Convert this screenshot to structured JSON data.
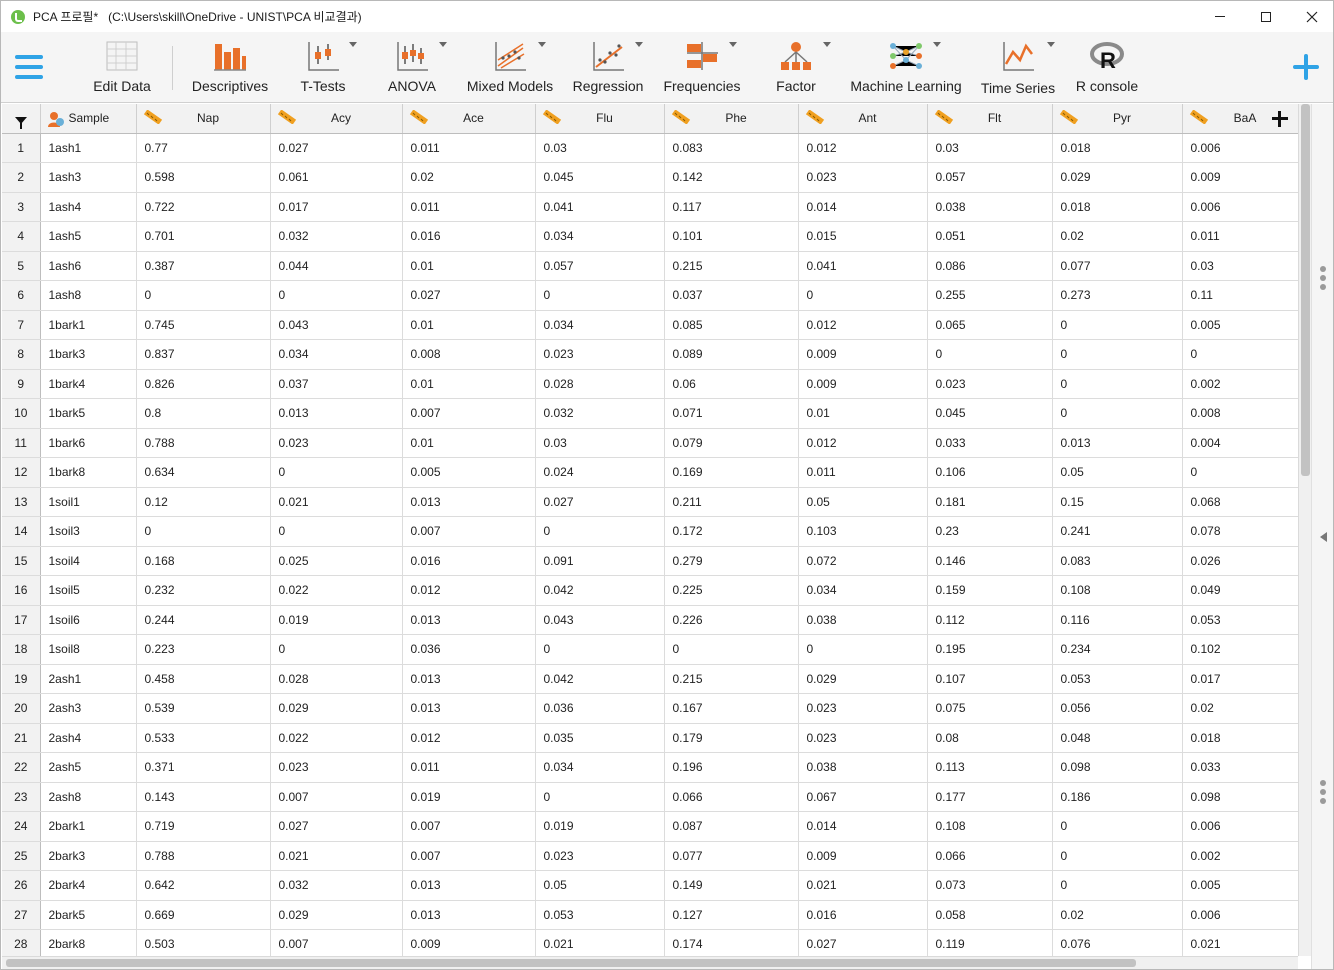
{
  "window": {
    "title": "PCA 프로필*",
    "path": "(C:\\Users\\skill\\OneDrive - UNIST\\PCA 비교결과)"
  },
  "ribbon": {
    "items": [
      {
        "label": "Edit Data",
        "icon": "spreadsheet-icon"
      },
      {
        "label": "Descriptives",
        "icon": "bar-chart-icon"
      },
      {
        "label": "T-Tests",
        "icon": "ttest-icon"
      },
      {
        "label": "ANOVA",
        "icon": "anova-icon"
      },
      {
        "label": "Mixed Models",
        "icon": "mixed-models-icon"
      },
      {
        "label": "Regression",
        "icon": "regression-icon"
      },
      {
        "label": "Frequencies",
        "icon": "frequencies-icon"
      },
      {
        "label": "Factor",
        "icon": "factor-icon"
      },
      {
        "label": "Machine Learning",
        "icon": "machine-learning-icon"
      },
      {
        "label": "Time Series",
        "icon": "time-series-icon"
      },
      {
        "label": "R console",
        "icon": "r-logo-icon"
      }
    ]
  },
  "grid": {
    "columns": [
      "Sample",
      "Nap",
      "Acy",
      "Ace",
      "Flu",
      "Phe",
      "Ant",
      "Flt",
      "Pyr",
      "BaA"
    ],
    "rows": [
      [
        "1",
        "1ash1",
        "0.77",
        "0.027",
        "0.011",
        "0.03",
        "0.083",
        "0.012",
        "0.03",
        "0.018",
        "0.006"
      ],
      [
        "2",
        "1ash3",
        "0.598",
        "0.061",
        "0.02",
        "0.045",
        "0.142",
        "0.023",
        "0.057",
        "0.029",
        "0.009"
      ],
      [
        "3",
        "1ash4",
        "0.722",
        "0.017",
        "0.011",
        "0.041",
        "0.117",
        "0.014",
        "0.038",
        "0.018",
        "0.006"
      ],
      [
        "4",
        "1ash5",
        "0.701",
        "0.032",
        "0.016",
        "0.034",
        "0.101",
        "0.015",
        "0.051",
        "0.02",
        "0.011"
      ],
      [
        "5",
        "1ash6",
        "0.387",
        "0.044",
        "0.01",
        "0.057",
        "0.215",
        "0.041",
        "0.086",
        "0.077",
        "0.03"
      ],
      [
        "6",
        "1ash8",
        "0",
        "0",
        "0.027",
        "0",
        "0.037",
        "0",
        "0.255",
        "0.273",
        "0.11"
      ],
      [
        "7",
        "1bark1",
        "0.745",
        "0.043",
        "0.01",
        "0.034",
        "0.085",
        "0.012",
        "0.065",
        "0",
        "0.005"
      ],
      [
        "8",
        "1bark3",
        "0.837",
        "0.034",
        "0.008",
        "0.023",
        "0.089",
        "0.009",
        "0",
        "0",
        "0"
      ],
      [
        "9",
        "1bark4",
        "0.826",
        "0.037",
        "0.01",
        "0.028",
        "0.06",
        "0.009",
        "0.023",
        "0",
        "0.002"
      ],
      [
        "10",
        "1bark5",
        "0.8",
        "0.013",
        "0.007",
        "0.032",
        "0.071",
        "0.01",
        "0.045",
        "0",
        "0.008"
      ],
      [
        "11",
        "1bark6",
        "0.788",
        "0.023",
        "0.01",
        "0.03",
        "0.079",
        "0.012",
        "0.033",
        "0.013",
        "0.004"
      ],
      [
        "12",
        "1bark8",
        "0.634",
        "0",
        "0.005",
        "0.024",
        "0.169",
        "0.011",
        "0.106",
        "0.05",
        "0"
      ],
      [
        "13",
        "1soil1",
        "0.12",
        "0.021",
        "0.013",
        "0.027",
        "0.211",
        "0.05",
        "0.181",
        "0.15",
        "0.068"
      ],
      [
        "14",
        "1soil3",
        "0",
        "0",
        "0.007",
        "0",
        "0.172",
        "0.103",
        "0.23",
        "0.241",
        "0.078"
      ],
      [
        "15",
        "1soil4",
        "0.168",
        "0.025",
        "0.016",
        "0.091",
        "0.279",
        "0.072",
        "0.146",
        "0.083",
        "0.026"
      ],
      [
        "16",
        "1soil5",
        "0.232",
        "0.022",
        "0.012",
        "0.042",
        "0.225",
        "0.034",
        "0.159",
        "0.108",
        "0.049"
      ],
      [
        "17",
        "1soil6",
        "0.244",
        "0.019",
        "0.013",
        "0.043",
        "0.226",
        "0.038",
        "0.112",
        "0.116",
        "0.053"
      ],
      [
        "18",
        "1soil8",
        "0.223",
        "0",
        "0.036",
        "0",
        "0",
        "0",
        "0.195",
        "0.234",
        "0.102"
      ],
      [
        "19",
        "2ash1",
        "0.458",
        "0.028",
        "0.013",
        "0.042",
        "0.215",
        "0.029",
        "0.107",
        "0.053",
        "0.017"
      ],
      [
        "20",
        "2ash3",
        "0.539",
        "0.029",
        "0.013",
        "0.036",
        "0.167",
        "0.023",
        "0.075",
        "0.056",
        "0.02"
      ],
      [
        "21",
        "2ash4",
        "0.533",
        "0.022",
        "0.012",
        "0.035",
        "0.179",
        "0.023",
        "0.08",
        "0.048",
        "0.018"
      ],
      [
        "22",
        "2ash5",
        "0.371",
        "0.023",
        "0.011",
        "0.034",
        "0.196",
        "0.038",
        "0.113",
        "0.098",
        "0.033"
      ],
      [
        "23",
        "2ash8",
        "0.143",
        "0.007",
        "0.019",
        "0",
        "0.066",
        "0.067",
        "0.177",
        "0.186",
        "0.098"
      ],
      [
        "24",
        "2bark1",
        "0.719",
        "0.027",
        "0.007",
        "0.019",
        "0.087",
        "0.014",
        "0.108",
        "0",
        "0.006"
      ],
      [
        "25",
        "2bark3",
        "0.788",
        "0.021",
        "0.007",
        "0.023",
        "0.077",
        "0.009",
        "0.066",
        "0",
        "0.002"
      ],
      [
        "26",
        "2bark4",
        "0.642",
        "0.032",
        "0.013",
        "0.05",
        "0.149",
        "0.021",
        "0.073",
        "0",
        "0.005"
      ],
      [
        "27",
        "2bark5",
        "0.669",
        "0.029",
        "0.013",
        "0.053",
        "0.127",
        "0.016",
        "0.058",
        "0.02",
        "0.006"
      ],
      [
        "28",
        "2bark8",
        "0.503",
        "0.007",
        "0.009",
        "0.021",
        "0.174",
        "0.027",
        "0.119",
        "0.076",
        "0.021"
      ]
    ]
  },
  "colors": {
    "accent": "#2fa3e6",
    "ruler": "#f0a020",
    "icon_orange": "#e8702a"
  }
}
